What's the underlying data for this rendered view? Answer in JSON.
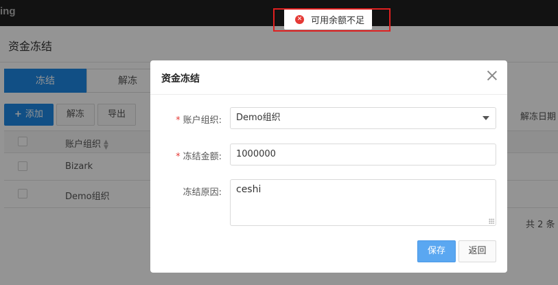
{
  "brand": "ing",
  "page": {
    "title": "资金冻结",
    "tabs": [
      {
        "label": "冻结",
        "active": true
      },
      {
        "label": "解冻",
        "active": false
      }
    ],
    "toolbar": {
      "add_label": "添加",
      "unfreeze_label": "解冻",
      "export_label": "导出"
    },
    "table": {
      "header_org": "账户组织",
      "header_unfreeze_date": "解冻日期",
      "rows": [
        {
          "org": "Bizark"
        },
        {
          "org": "Demo组织"
        }
      ],
      "total": "共 2 条"
    }
  },
  "toast": {
    "message": "可用余额不足",
    "type": "error"
  },
  "modal": {
    "title": "资金冻结",
    "fields": {
      "org": {
        "label": "账户组织:",
        "value": "Demo组织",
        "required": true
      },
      "amount": {
        "label": "冻结金额:",
        "value": "1000000",
        "required": true
      },
      "reason": {
        "label": "冻结原因:",
        "value": "ceshi",
        "required": false
      }
    },
    "save_label": "保存",
    "back_label": "返回"
  },
  "colors": {
    "primary": "#1e88e5",
    "error": "#e53935",
    "save_button": "#5aa7f1"
  }
}
